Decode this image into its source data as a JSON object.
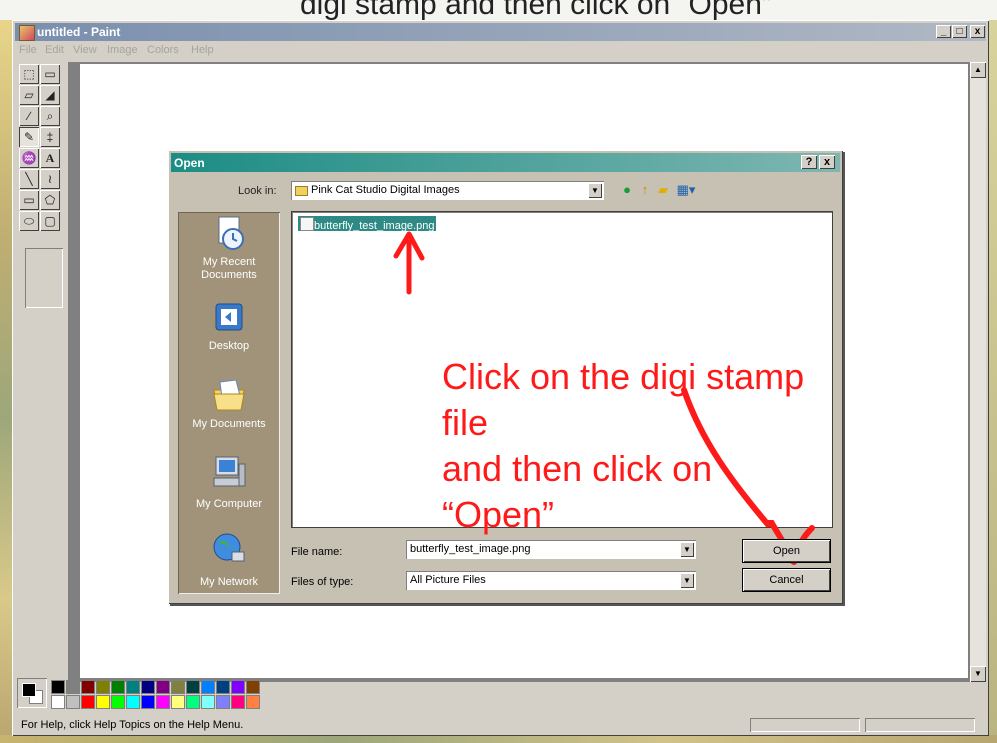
{
  "banner_text": "digi stamp and then click on “Open”",
  "paint": {
    "title": "untitled - Paint",
    "window_buttons": {
      "minimize": "_",
      "maximize": "□",
      "close": "x"
    },
    "menu": [
      "File",
      "Edit",
      "View",
      "Image",
      "Colors",
      "Help"
    ],
    "tools": [
      {
        "name": "free-select-tool",
        "glyph": "⬚"
      },
      {
        "name": "rect-select-tool",
        "glyph": "▭"
      },
      {
        "name": "eraser-tool",
        "glyph": "▱"
      },
      {
        "name": "fill-tool",
        "glyph": "◢"
      },
      {
        "name": "pick-color-tool",
        "glyph": "∕"
      },
      {
        "name": "magnifier-tool",
        "glyph": "⌕"
      },
      {
        "name": "pencil-tool",
        "glyph": "✎"
      },
      {
        "name": "brush-tool",
        "glyph": "‡"
      },
      {
        "name": "airbrush-tool",
        "glyph": "♒"
      },
      {
        "name": "text-tool",
        "glyph": "A"
      },
      {
        "name": "line-tool",
        "glyph": "╲"
      },
      {
        "name": "curve-tool",
        "glyph": "≀"
      },
      {
        "name": "rectangle-tool",
        "glyph": "▭"
      },
      {
        "name": "polygon-tool",
        "glyph": "⬠"
      },
      {
        "name": "ellipse-tool",
        "glyph": "⬭"
      },
      {
        "name": "rounded-rect-tool",
        "glyph": "▢"
      }
    ],
    "palette": [
      "#000000",
      "#808080",
      "#800000",
      "#808000",
      "#008000",
      "#008080",
      "#000080",
      "#800080",
      "#808040",
      "#004040",
      "#0080ff",
      "#004080",
      "#8000ff",
      "#804000",
      "#ffffff",
      "#c0c0c0",
      "#ff0000",
      "#ffff00",
      "#00ff00",
      "#00ffff",
      "#0000ff",
      "#ff00ff",
      "#ffff80",
      "#00ff80",
      "#80ffff",
      "#8080ff",
      "#ff0080",
      "#ff8040"
    ],
    "status_text": "For Help, click Help Topics on the Help Menu."
  },
  "dialog": {
    "title": "Open",
    "help_button": "?",
    "close_button": "x",
    "look_in_label": "Look in:",
    "look_in_value": "Pink Cat Studio Digital Images",
    "places": [
      {
        "label": "My Recent Documents",
        "icon": "recent-documents-icon"
      },
      {
        "label": "Desktop",
        "icon": "desktop-icon"
      },
      {
        "label": "My Documents",
        "icon": "my-documents-icon"
      },
      {
        "label": "My Computer",
        "icon": "my-computer-icon"
      },
      {
        "label": "My Network",
        "icon": "my-network-icon"
      }
    ],
    "files": [
      {
        "name": "butterfly_test_image.png",
        "selected": true
      }
    ],
    "file_name_label": "File name:",
    "file_name_value": "butterfly_test_image.png",
    "files_of_type_label": "Files of type:",
    "files_of_type_value": "All Picture Files",
    "open_button": "Open",
    "cancel_button": "Cancel"
  },
  "annotation": {
    "line1": "Click on the digi stamp file",
    "line2": "and then click on “Open”",
    "color": "#ff1a1a"
  }
}
